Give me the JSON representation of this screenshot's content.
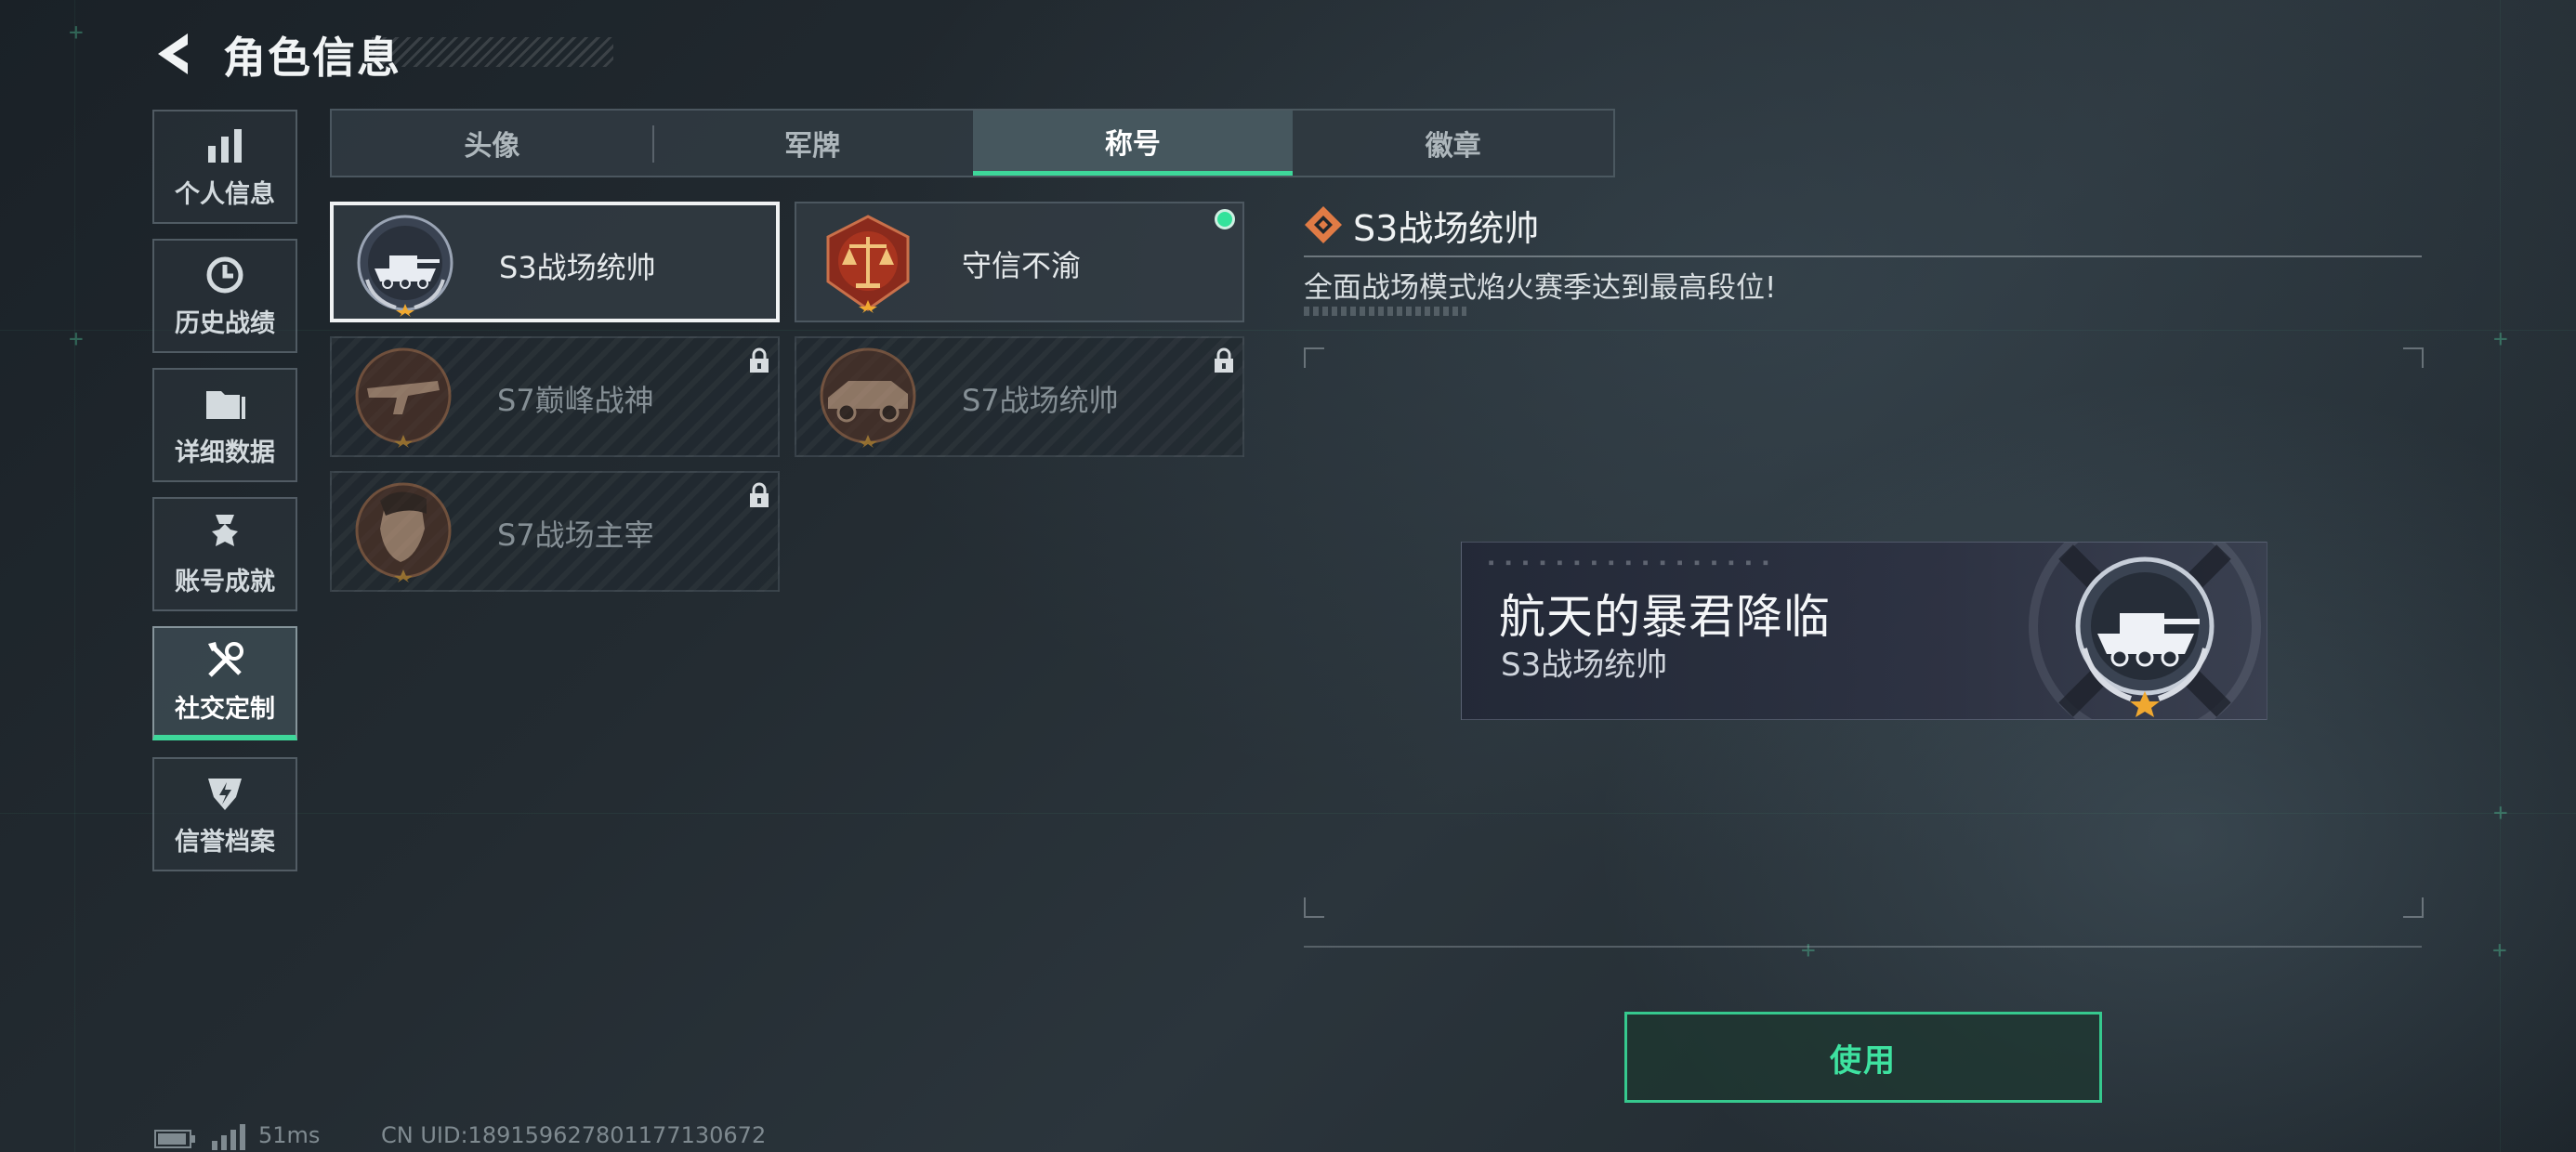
{
  "header": {
    "title": "角色信息"
  },
  "sidebar": {
    "items": [
      {
        "label": "个人信息",
        "icon": "bar-chart-icon",
        "active": false
      },
      {
        "label": "历史战绩",
        "icon": "history-clock-icon",
        "active": false
      },
      {
        "label": "详细数据",
        "icon": "folder-icon",
        "active": false
      },
      {
        "label": "账号成就",
        "icon": "medal-icon",
        "active": false
      },
      {
        "label": "社交定制",
        "icon": "tools-icon",
        "active": true
      },
      {
        "label": "信誉档案",
        "icon": "shield-bolt-icon",
        "active": false
      }
    ]
  },
  "tabs": [
    {
      "label": "头像",
      "active": false
    },
    {
      "label": "军牌",
      "active": false
    },
    {
      "label": "称号",
      "active": true
    },
    {
      "label": "徽章",
      "active": false
    }
  ],
  "titles": [
    {
      "name": "S3战场统帅",
      "badge": "tank-badge-icon",
      "locked": false,
      "selected": true,
      "equipped": false
    },
    {
      "name": "守信不渝",
      "badge": "scales-badge-icon",
      "locked": false,
      "selected": false,
      "equipped": true
    },
    {
      "name": "S7巅峰战神",
      "badge": "rifle-badge-icon",
      "locked": true,
      "selected": false,
      "equipped": false
    },
    {
      "name": "S7战场统帅",
      "badge": "vehicle-badge-icon",
      "locked": true,
      "selected": false,
      "equipped": false
    },
    {
      "name": "S7战场主宰",
      "badge": "soldier-badge-icon",
      "locked": true,
      "selected": false,
      "equipped": false
    }
  ],
  "detail": {
    "title": "S3战场统帅",
    "description": "全面战场模式焰火赛季达到最高段位!"
  },
  "preview": {
    "title": "航天的暴君降临",
    "subtitle": "S3战场统帅"
  },
  "use_button": {
    "label": "使用"
  },
  "status": {
    "ping": "51ms",
    "uid": "CN UID:18915962780117713067​2"
  },
  "colors": {
    "accent": "#3ed79a",
    "equipped_dot": "#34e29b",
    "detail_icon": "#e07b45",
    "badge_star": "#f0a830"
  }
}
